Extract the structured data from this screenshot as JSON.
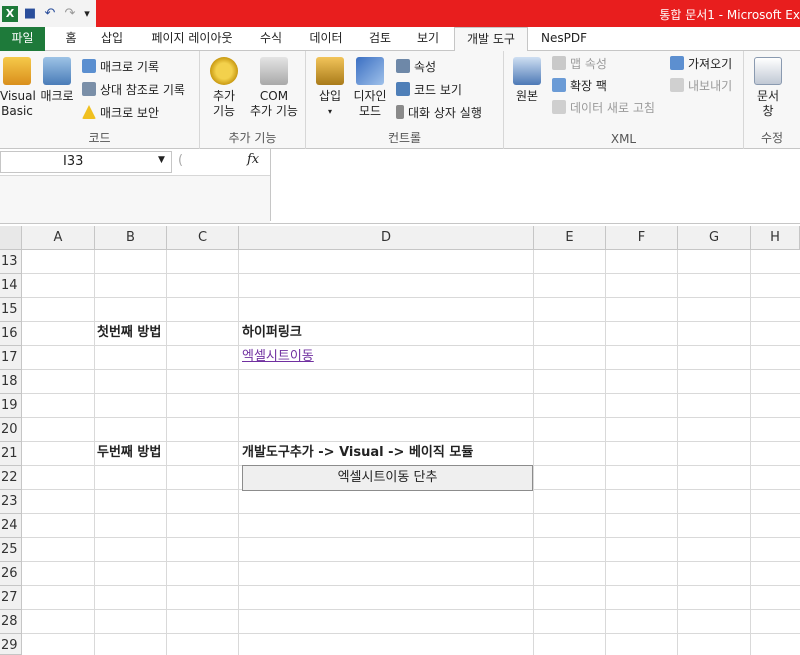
{
  "window": {
    "title": "통합 문서1 - Microsoft Ex"
  },
  "quick_access": [
    {
      "name": "excel-logo-icon",
      "glyph": "X"
    },
    {
      "name": "save-icon",
      "glyph": "■"
    },
    {
      "name": "undo-icon",
      "glyph": "↶"
    },
    {
      "name": "redo-icon",
      "glyph": "↷"
    },
    {
      "name": "customize-qat-icon",
      "glyph": "▾"
    }
  ],
  "tabs": [
    "파일",
    "홈",
    "삽입",
    "페이지 레이아웃",
    "수식",
    "데이터",
    "검토",
    "보기",
    "개발 도구",
    "NesPDF"
  ],
  "ribbon": {
    "code": {
      "label": "코드",
      "visual_basic_line1": "Visual",
      "visual_basic_line2": "Basic",
      "macro": "매크로",
      "record_macro": "매크로 기록",
      "relative_ref": "상대 참조로 기록",
      "macro_security": "매크로 보안"
    },
    "addins": {
      "label": "추가 기능",
      "addins_line1": "추가",
      "addins_line2": "기능",
      "com_line1": "COM",
      "com_line2": "추가 기능"
    },
    "controls": {
      "label": "컨트롤",
      "insert": "삽입",
      "insert_arrow": "▾",
      "design_line1": "디자인",
      "design_line2": "모드",
      "properties": "속성",
      "view_code": "코드 보기",
      "run_dialog": "대화 상자 실행"
    },
    "xml": {
      "label": "XML",
      "source": "원본",
      "map_properties": "맵 속성",
      "expansion_packs": "확장 팩",
      "refresh_data": "데이터 새로 고침",
      "import": "가져오기",
      "export": "내보내기"
    },
    "modify": {
      "label": "수정",
      "doc_panel_line1": "문서",
      "doc_panel_line2": "창"
    }
  },
  "formula_bar": {
    "name_box": "I33",
    "fx": "fx",
    "formula": ""
  },
  "columns": [
    "A",
    "B",
    "C",
    "D",
    "E",
    "F",
    "G",
    "H"
  ],
  "rows": [
    "13",
    "14",
    "15",
    "16",
    "17",
    "18",
    "19",
    "20",
    "21",
    "22",
    "23",
    "24",
    "25",
    "26",
    "27",
    "28",
    "29"
  ],
  "cells": {
    "B16": "첫번째 방법",
    "D16": "하이퍼링크",
    "D17": "엑셀시트이동",
    "B21": "두번째 방법",
    "D21": "개발도구추가 -> Visual -> 베이직 모듈"
  },
  "shape_button": {
    "label": "엑셀시트이동 단추"
  },
  "colors": {
    "title_bar": "#e81e1e",
    "file_tab": "#1e7a3a",
    "hyperlink": "#7030a0"
  }
}
